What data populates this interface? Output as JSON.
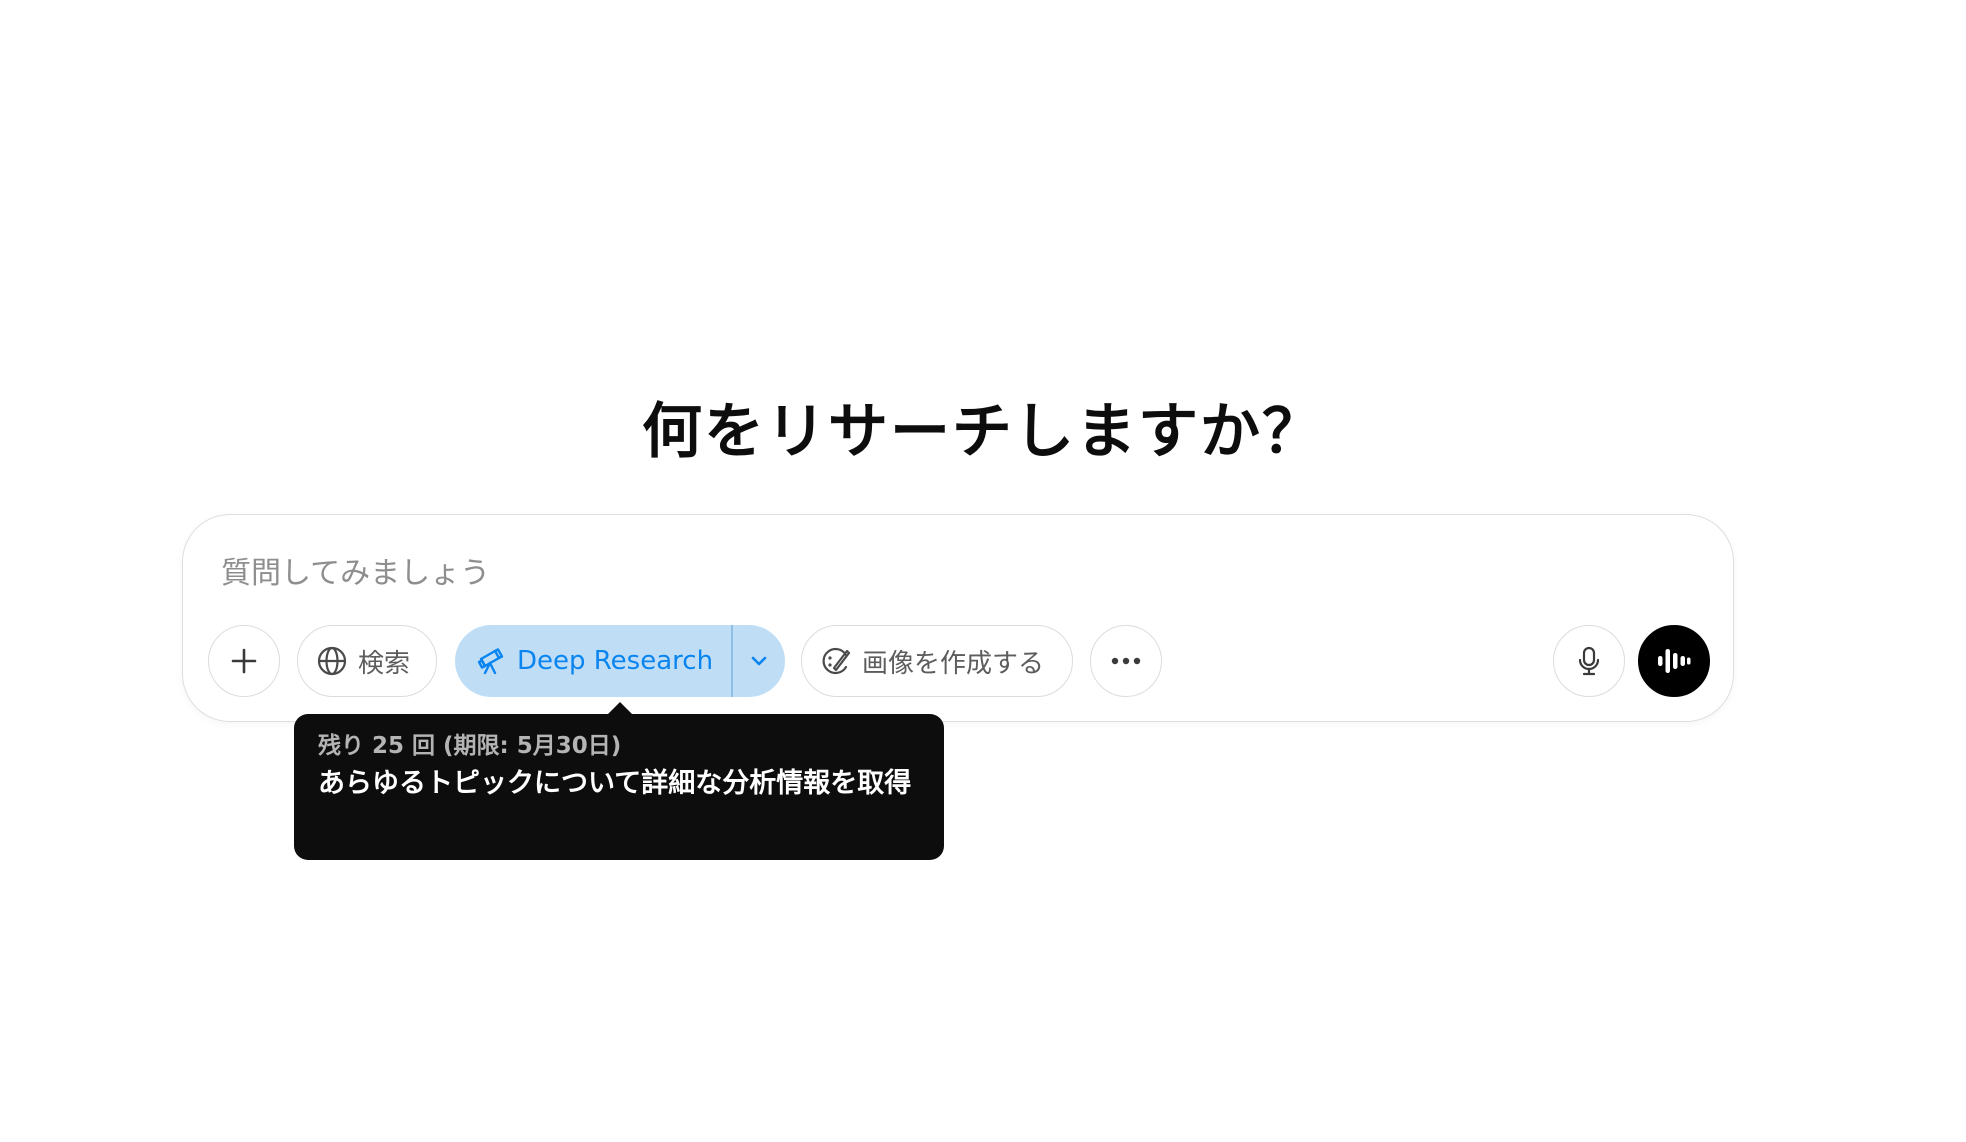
{
  "main": {
    "heading": "何をリサーチしますか？"
  },
  "composer": {
    "placeholder": "質問してみましょう",
    "value": ""
  },
  "toolbar": {
    "search_label": "検索",
    "deep_research_label": "Deep Research",
    "create_image_label": "画像を作成する"
  },
  "tooltip": {
    "remaining": "残り 25 回 (期限: 5月30日)",
    "description": "あらゆるトピックについて詳細な分析情報を取得"
  },
  "colors": {
    "accent": "#0a85f0",
    "deep_research_bg": "#bfdef6",
    "voice_button_bg": "#000000",
    "tooltip_bg": "#0d0d0d"
  },
  "icons": {
    "add": "plus-icon",
    "search": "globe-icon",
    "deep_research": "telescope-icon",
    "deep_research_menu": "chevron-down-icon",
    "create_image": "palette-icon",
    "more": "ellipsis-icon",
    "mic": "microphone-icon",
    "voice": "voice-waveform-icon"
  }
}
